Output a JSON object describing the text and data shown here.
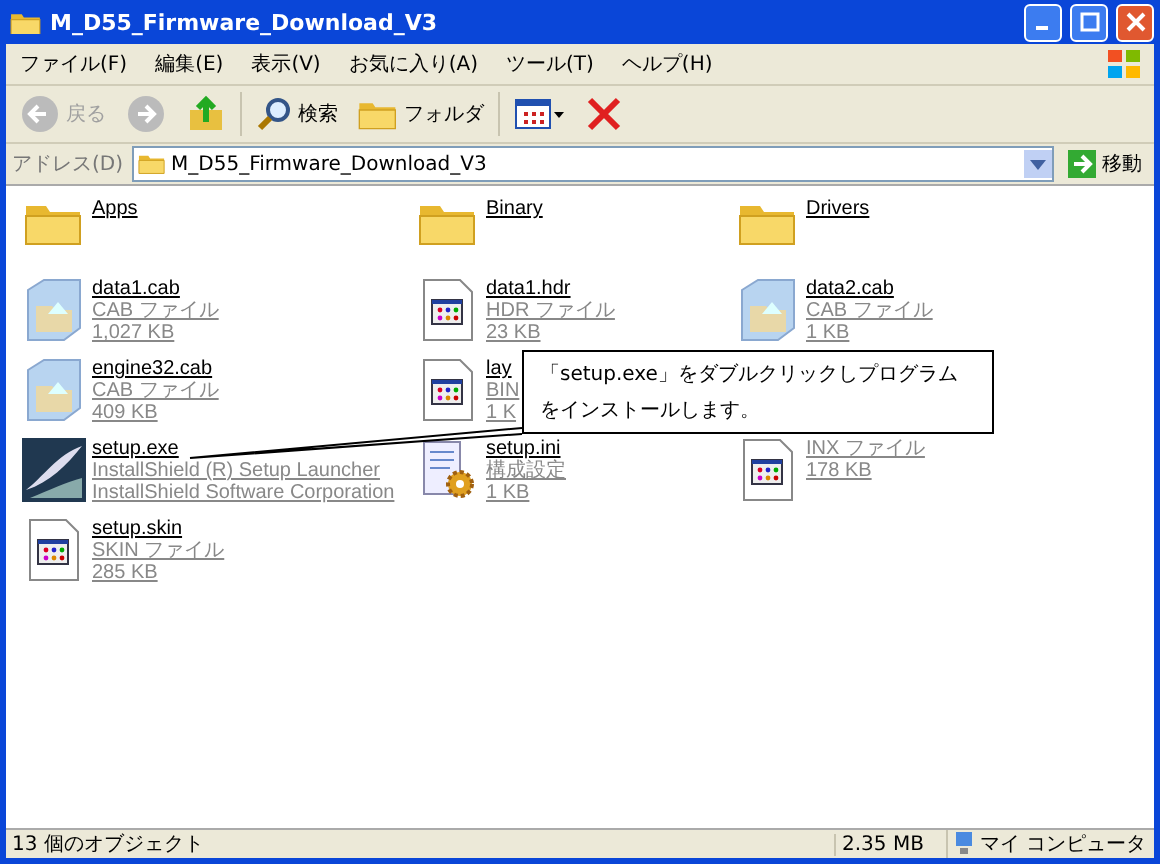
{
  "window": {
    "title": "M_D55_Firmware_Download_V3"
  },
  "menu": [
    "ファイル(F)",
    "編集(E)",
    "表示(V)",
    "お気に入り(A)",
    "ツール(T)",
    "ヘルプ(H)"
  ],
  "toolbar": [
    {
      "kind": "back",
      "label": "戻る",
      "disabled": true
    },
    {
      "kind": "forward",
      "disabled": true
    },
    {
      "kind": "up"
    },
    {
      "kind": "search",
      "label": "検索",
      "disabled": false
    },
    {
      "kind": "folders",
      "label": "フォルダ",
      "disabled": false
    },
    {
      "kind": "views"
    },
    {
      "kind": "delete",
      "disabled": false
    }
  ],
  "address": {
    "label": "アドレス(D)",
    "value": "M_D55_Firmware_Download_V3",
    "go": "移動"
  },
  "rows": [
    [
      {
        "kind": "folder",
        "name": "Apps"
      },
      {
        "kind": "folder",
        "name": "Binary"
      },
      {
        "kind": "folder",
        "name": "Drivers"
      }
    ],
    [
      {
        "kind": "cab",
        "name": "data1.cab",
        "details": [
          "CAB ファイル",
          "1,027 KB"
        ]
      },
      {
        "kind": "doc",
        "name": "data1.hdr",
        "details": [
          "HDR ファイル",
          "23 KB"
        ]
      },
      {
        "kind": "cab",
        "name": "data2.cab",
        "details": [
          "CAB ファイル",
          "1 KB"
        ]
      }
    ],
    [
      {
        "kind": "cab",
        "name": "engine32.cab",
        "details": [
          "CAB ファイル",
          "409 KB"
        ]
      },
      {
        "kind": "doc",
        "name": "lay",
        "details": [
          "BIN",
          "1 K"
        ]
      }
    ],
    [
      {
        "kind": "exe",
        "name": "setup.exe",
        "details": [
          "InstallShield (R) Setup Launcher",
          "InstallShield Software Corporation"
        ]
      },
      {
        "kind": "ini",
        "name": "setup.ini",
        "details": [
          "構成設定",
          "1 KB"
        ]
      },
      {
        "kind": "doc",
        "details": [
          "INX ファイル",
          "178 KB"
        ]
      }
    ],
    [
      {
        "kind": "doc",
        "name": "setup.skin",
        "details": [
          "SKIN ファイル",
          "285 KB"
        ]
      }
    ]
  ],
  "callout": [
    "「setup.exe」をダブルクリックしプログラム",
    "をインストールします。"
  ],
  "status_bar": {
    "count": "13 個のオブジェクト",
    "size": "2.35 MB",
    "location": "マイ コンピュータ"
  }
}
